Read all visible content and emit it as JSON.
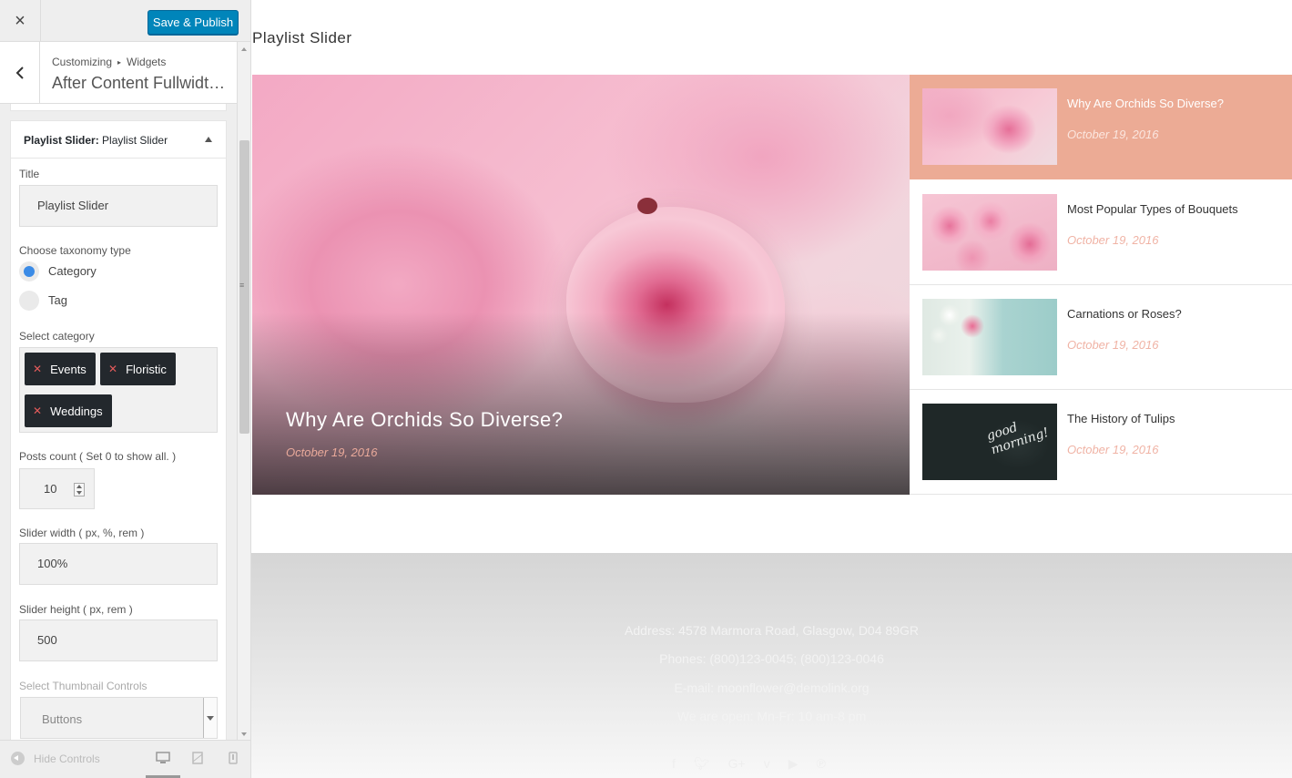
{
  "topbar": {
    "close_icon": "×",
    "publish_label": "Save & Publish",
    "publish_color": "#0085ba"
  },
  "section": {
    "crumb_root": "Customizing",
    "crumb_sep": "▸",
    "crumb_child": "Widgets",
    "title": "After Content Fullwidth..."
  },
  "widget": {
    "title_prefix": "Playlist Slider:",
    "title_name": "Playlist Slider",
    "fields": {
      "title_label": "Title",
      "title_value": "Playlist Slider",
      "taxonomy_label": "Choose taxonomy type",
      "taxonomy_options": [
        "Category",
        "Tag"
      ],
      "taxonomy_selected": "Category",
      "category_label": "Select category",
      "categories": [
        "Events",
        "Floristic",
        "Weddings"
      ],
      "posts_count_label": "Posts count ( Set 0 to show all. )",
      "posts_count_value": "10",
      "slider_width_label": "Slider width ( px, %, rem )",
      "slider_width_value": "100%",
      "slider_height_label": "Slider height ( px, rem )",
      "slider_height_value": "500",
      "thumb_controls_label": "Select Thumbnail Controls",
      "thumb_controls_value": "Buttons"
    }
  },
  "footer_bar": {
    "hide_controls_label": "Hide Controls",
    "devices": [
      "desktop-icon",
      "tablet-icon",
      "mobile-icon"
    ]
  },
  "preview": {
    "widget_title": "Playlist Slider",
    "hero": {
      "title": "Why Are Orchids So Diverse?",
      "date": "October 19, 2016"
    },
    "playlist": [
      {
        "title": "Why Are Orchids So Diverse?",
        "date": "October 19, 2016",
        "active": true
      },
      {
        "title": "Most Popular Types of Bouquets",
        "date": "October 19, 2016",
        "active": false
      },
      {
        "title": "Carnations or Roses?",
        "date": "October 19, 2016",
        "active": false
      },
      {
        "title": "The History of Tulips",
        "date": "October 19, 2016",
        "active": false
      }
    ],
    "accent_color": "#ecab95",
    "footer": {
      "address": "Address: 4578 Marmora Road, Glasgow, D04 89GR",
      "phones": "Phones: (800)123-0045; (800)123-0046",
      "email_prefix": "E-mail:",
      "email": "moonflower@demolink.org",
      "hours": "We are open: Mn-Fr: 10 am-8 pm"
    },
    "social": [
      "facebook-icon",
      "twitter-icon",
      "google-plus-icon",
      "vimeo-icon",
      "youtube-icon",
      "pinterest-icon"
    ]
  }
}
